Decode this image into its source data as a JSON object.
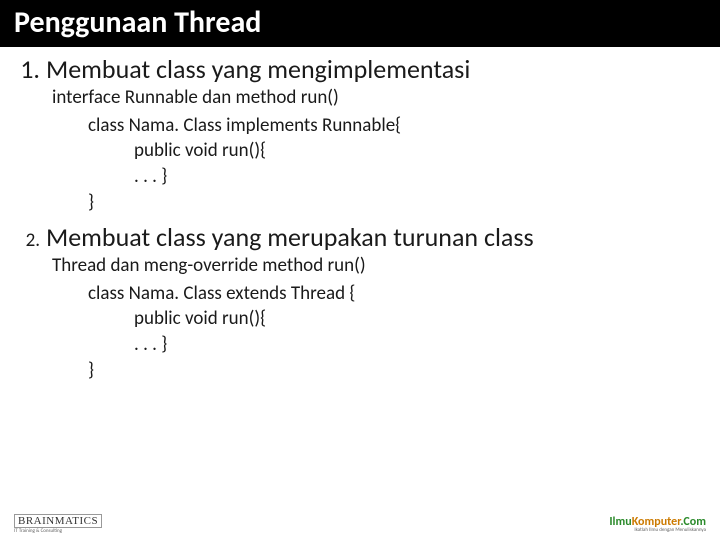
{
  "title": "Penggunaan Thread",
  "item1": {
    "num": "1.",
    "heading": "Membuat class yang mengimplementasi",
    "sub": "interface Runnable dan method run()",
    "code": {
      "l1": "class Nama. Class implements Runnable{",
      "l2": "public void run(){",
      "l3": ". . . }",
      "l4": "}"
    }
  },
  "item2": {
    "num": "2.",
    "heading": "Membuat class yang merupakan turunan class",
    "sub": "Thread dan meng-override method run()",
    "code": {
      "l1": "class Nama. Class extends Thread {",
      "l2": "public void run(){",
      "l3": ". . . }",
      "l4": "}"
    }
  },
  "footer": {
    "left": "BRAINMATICS",
    "left_sub": "IT Training & Consulting",
    "right_ilmu": "Ilmu",
    "right_komputer": "Komputer",
    "right_com": ".Com",
    "right_sub": "Ikatlah Ilmu dengan Menuliskannya"
  }
}
